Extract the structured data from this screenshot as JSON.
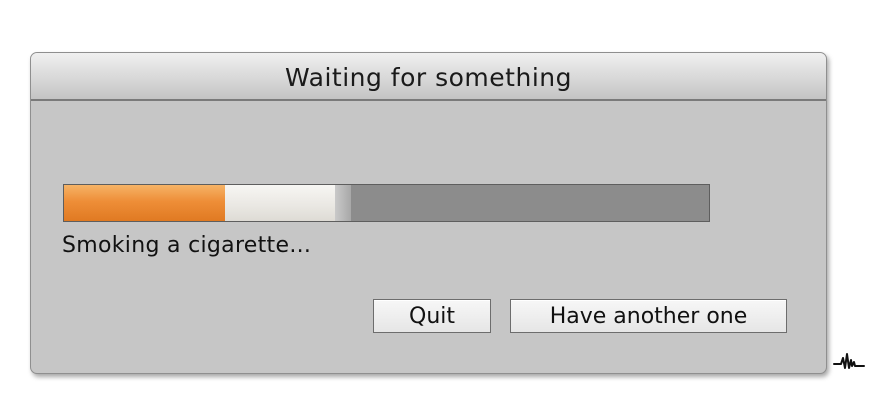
{
  "dialog": {
    "title": "Waiting for something",
    "status_text": "Smoking a cigarette...",
    "progress": {
      "burned_fraction": 0.25,
      "ash_fraction": 0.17,
      "tip_fraction": 0.025,
      "colors": {
        "burned": "#ee8e38",
        "ash": "#e9e7e2",
        "unburned": "#8c8c8c"
      }
    },
    "buttons": {
      "quit_label": "Quit",
      "another_label": "Have another one"
    }
  },
  "colors": {
    "dialog_background": "#c6c6c6",
    "title_gradient_top": "#f0f0f0",
    "title_gradient_bottom": "#c4c4c4"
  },
  "logo": {
    "icon": "signature-logo-icon"
  }
}
